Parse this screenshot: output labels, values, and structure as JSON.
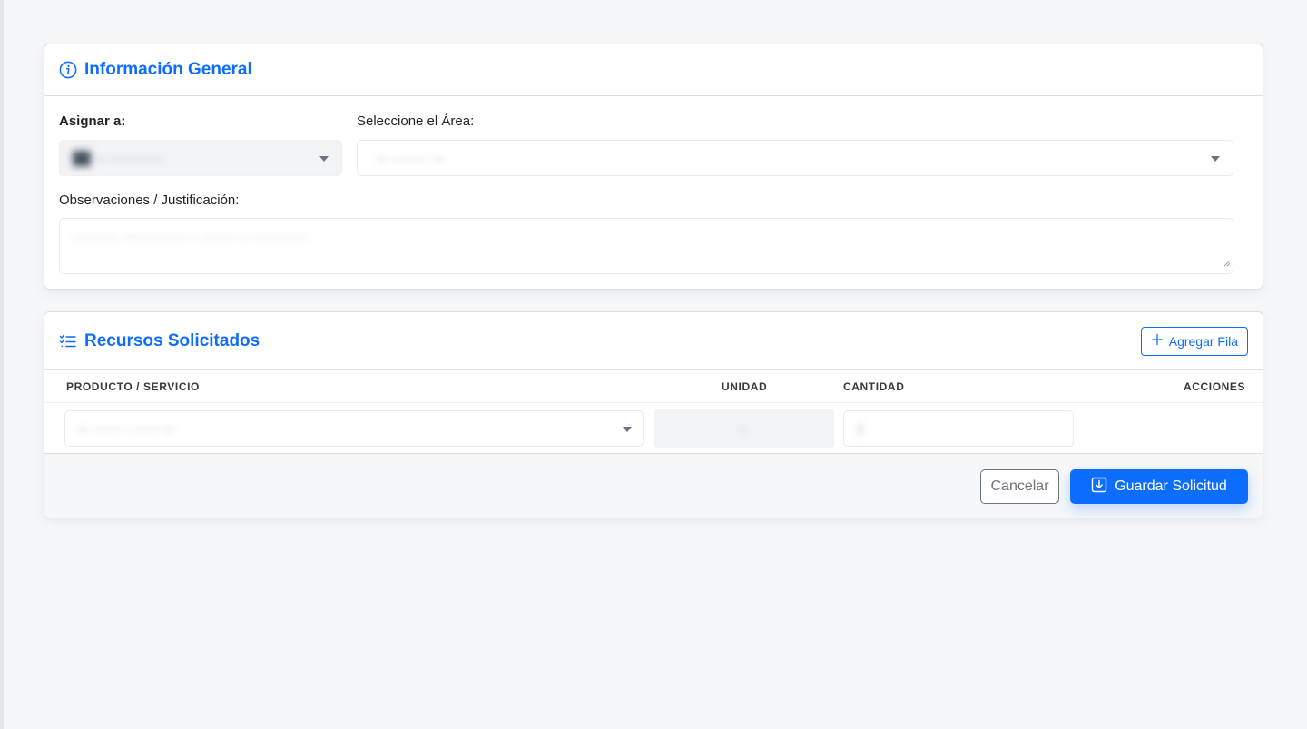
{
  "info_card": {
    "title": "Información General",
    "title_icon": "info-circle-icon",
    "assign_label": "Asignar a:",
    "assign_value": "██ ··· ·············",
    "area_label": "Seleccione el Área:",
    "area_value": "-- ·········· --",
    "obs_label": "Observaciones / Justificación:",
    "obs_value": "··········· ··············· ·· ········ ··· ············"
  },
  "resources_card": {
    "title": "Recursos Solicitados",
    "title_icon": "checklist-icon",
    "add_row_label": "Agregar Fila",
    "add_row_icon": "plus-icon",
    "columns": [
      "PRODUCTO / SERVICIO",
      "UNIDAD",
      "CANTIDAD",
      "ACCIONES"
    ],
    "row": {
      "product_value": "-- ········ ········ --",
      "unit_value": "--",
      "qty_value": "1"
    }
  },
  "footer": {
    "cancel_label": "Cancelar",
    "save_label": "Guardar Solicitud",
    "save_icon": "download-icon"
  },
  "colors": {
    "accent": "#0d6efd",
    "background": "#f6f7f9",
    "border": "#dcdfe4"
  }
}
